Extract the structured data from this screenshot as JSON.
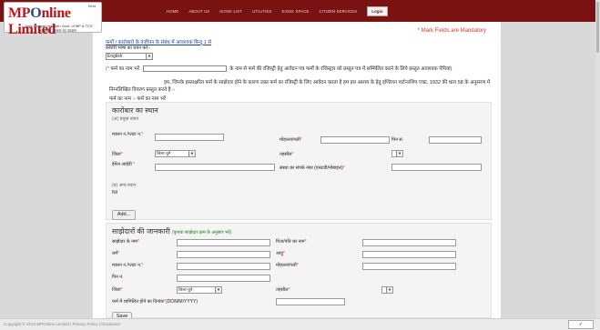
{
  "header": {
    "logo_beta": "Beta",
    "logo_mp": "MP",
    "logo_o": "O",
    "logo_rest": "nline Limited",
    "logo_sub1": "Joint Venture between Govt. of MP & TCS",
    "logo_sub2": "मध्यप्रदेश सरकार का उपक्रम",
    "nav": [
      "HOME",
      "ABOUT US",
      "KIOSK LIST",
      "UTILITIES",
      "KIOSK SPACE",
      "CITIZEN SERVICES"
    ],
    "login": "Login"
  },
  "form": {
    "mandatory_note": "* Mark Fields are Mandatory",
    "breadcrumb": "फर्मो / कारोबारो के पंजीयन के संबंध में आवश्यक बिन्दु 1 से",
    "language_label": "कोशेरी भाषा का चयन करें:-",
    "language_value": "English",
    "decl_prefix": "(*",
    "decl_hint": "फर्म का नाम भरें",
    "decl_suffix": "के नाम से फर्म की रजिस्ट्री हेतु आवेदन पत्र फर्मों के रजिस्ट्रार को प्रस्तुत पत्र में सम्मिलित करने के लिये प्रस्तुत आवश्यक पेपियां)",
    "paragraph": "हम, जिनके हस्ताक्षरित फर्म के साझेदार होने के कारण उक्त फर्म का रजिस्ट्री के लिए आवेदन करता है हम इस आशय के हेतु इण्डियन पार्टनरशिप एक्ट, 1932 की धारा 58 के अनुसरण में निम्नलिखित विवरण प्रस्तुत करते है :-",
    "firm_name_line": "फर्म का नाम :-  फर्म का नाम भरें"
  },
  "business_place": {
    "title": "कारोबार का स्थान",
    "main_place": "(अ) प्रमुख स्थान",
    "house_no_label": "मकान न./प्लाट न.",
    "locality_label": "मोहल्ला/गली",
    "pincode_label": "पिन सं.",
    "district_label": "जिला",
    "district_value": "जिला चुने",
    "tehsil_label": "तहसील",
    "email_label": "ईमेल आईडी",
    "contact_label": "संस्था का संपर्क नंबर (एसटडी/मोबाइल)",
    "other_place": "(ब) अन्य स्थान",
    "other_value": "Nil",
    "add_button": "Add..."
  },
  "partners": {
    "title": "साझेदारों की जानकारी",
    "hint": "(कृपया साझेदार क्रम के अनुसार भरें)",
    "name_label": "साझेदार के नाम",
    "father_label": "पिता/पति का नाम",
    "caste_label": "धर्म",
    "age_label": "आयु",
    "house_label": "मकान न./प्लाट न.",
    "locality_label": "मोहल्ला/गली",
    "pin_label": "पिन नं.",
    "district_label": "जिला",
    "district_value": "जिला चुने",
    "tehsil_label": "तहसील",
    "date_label": "फर्म में शामिलित होने का दिनांक",
    "date_format": "(DD/MM/YYYY)",
    "save_button": "Save"
  },
  "footer": {
    "text": "Copyright © 2013 MPOnline Limited  |  Privacy Policy  |  Disclaimer",
    "badge": "✓"
  }
}
